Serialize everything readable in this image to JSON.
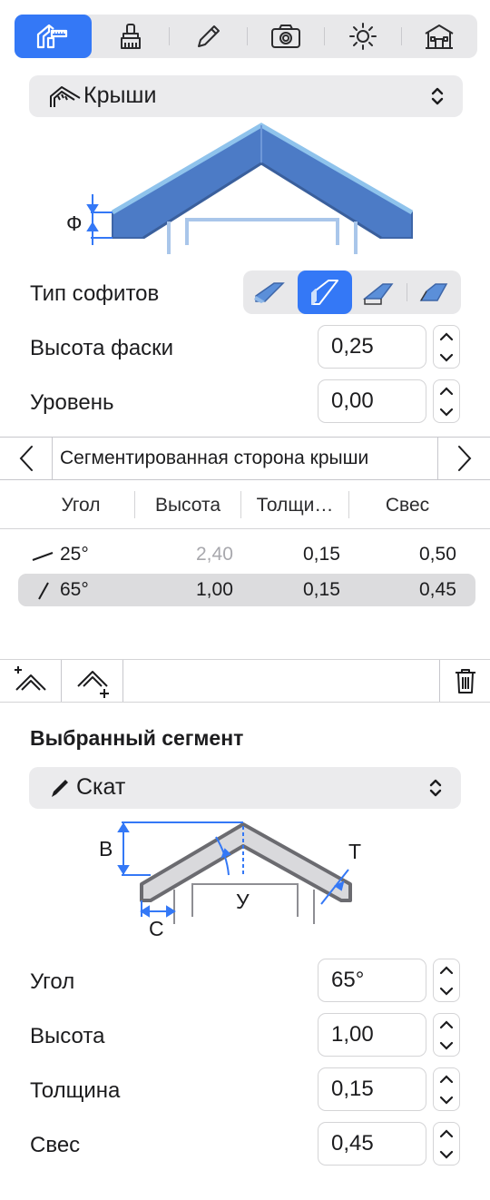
{
  "toolbar": {
    "tools": [
      {
        "icon": "roof-settings-icon",
        "selected": true
      },
      {
        "icon": "paint-roller-icon",
        "selected": false
      },
      {
        "icon": "pencil-icon",
        "selected": false
      },
      {
        "icon": "camera-icon",
        "selected": false
      },
      {
        "icon": "sun-icon",
        "selected": false
      },
      {
        "icon": "house-icon",
        "selected": false
      }
    ],
    "accent": "#3478f6"
  },
  "category": {
    "label": "Крыши",
    "icon": "roof-icon"
  },
  "preview": {
    "dimension_label": "Ф"
  },
  "soffit": {
    "label": "Тип софитов",
    "selected_index": 1
  },
  "fields": {
    "chamfer": {
      "label": "Высота фаски",
      "value": "0,25"
    },
    "level": {
      "label": "Уровень",
      "value": "0,00"
    }
  },
  "navigator": {
    "title": "Сегментированная сторона крыши"
  },
  "table": {
    "columns": [
      "Угол",
      "Высота",
      "Толщи…",
      "Свес"
    ],
    "rows": [
      {
        "angle": "25°",
        "height": "2,40",
        "thickness": "0,15",
        "overhang": "0,50",
        "selected": false,
        "height_dimmed": true
      },
      {
        "angle": "65°",
        "height": "1,00",
        "thickness": "0,15",
        "overhang": "0,45",
        "selected": true,
        "height_dimmed": false
      }
    ]
  },
  "segment": {
    "title": "Выбранный сегмент",
    "type_label": "Скат",
    "diagram_labels": {
      "b": "B",
      "t": "T",
      "u": "У",
      "c": "C"
    },
    "fields": {
      "angle": {
        "label": "Угол",
        "value": "65°"
      },
      "height": {
        "label": "Высота",
        "value": "1,00"
      },
      "thickness": {
        "label": "Толщина",
        "value": "0,15"
      },
      "overhang": {
        "label": "Свес",
        "value": "0,45"
      }
    }
  }
}
